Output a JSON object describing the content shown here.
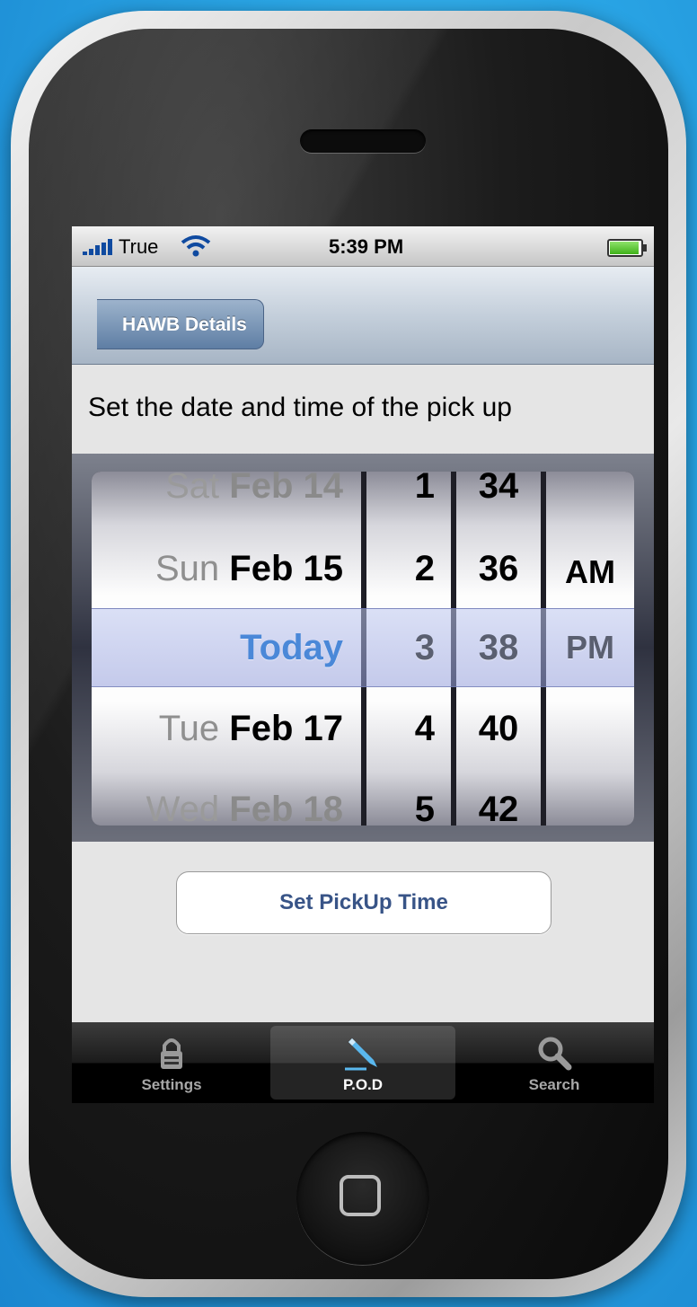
{
  "status_bar": {
    "carrier": "True",
    "time": "5:39 PM"
  },
  "nav": {
    "back_label": "HAWB Details"
  },
  "instruction": "Set the date and time of the pick up",
  "picker": {
    "date_items": [
      {
        "weekday": "Sat",
        "date": "Feb 14"
      },
      {
        "weekday": "Sun",
        "date": "Feb 15"
      },
      {
        "weekday": "",
        "date": ""
      },
      {
        "weekday": "Tue",
        "date": "Feb 17"
      },
      {
        "weekday": "Wed",
        "date": "Feb 18"
      }
    ],
    "selected_date": "Today",
    "hours": [
      "1",
      "2",
      "3",
      "4",
      "5"
    ],
    "minutes": [
      "34",
      "36",
      "38",
      "40",
      "42"
    ],
    "ampm": [
      "AM",
      "PM"
    ]
  },
  "set_button_label": "Set PickUp Time",
  "tabbar": {
    "tabs": [
      "Settings",
      "P.O.D",
      "Search"
    ],
    "active": "P.O.D"
  },
  "colors": {
    "accent": "#4a88d8",
    "nav": "#a7b5c5",
    "button_text": "#385487"
  },
  "icons": [
    "signal-icon",
    "wifi-icon",
    "battery-icon",
    "lock-icon",
    "pencil-icon",
    "search-icon"
  ]
}
